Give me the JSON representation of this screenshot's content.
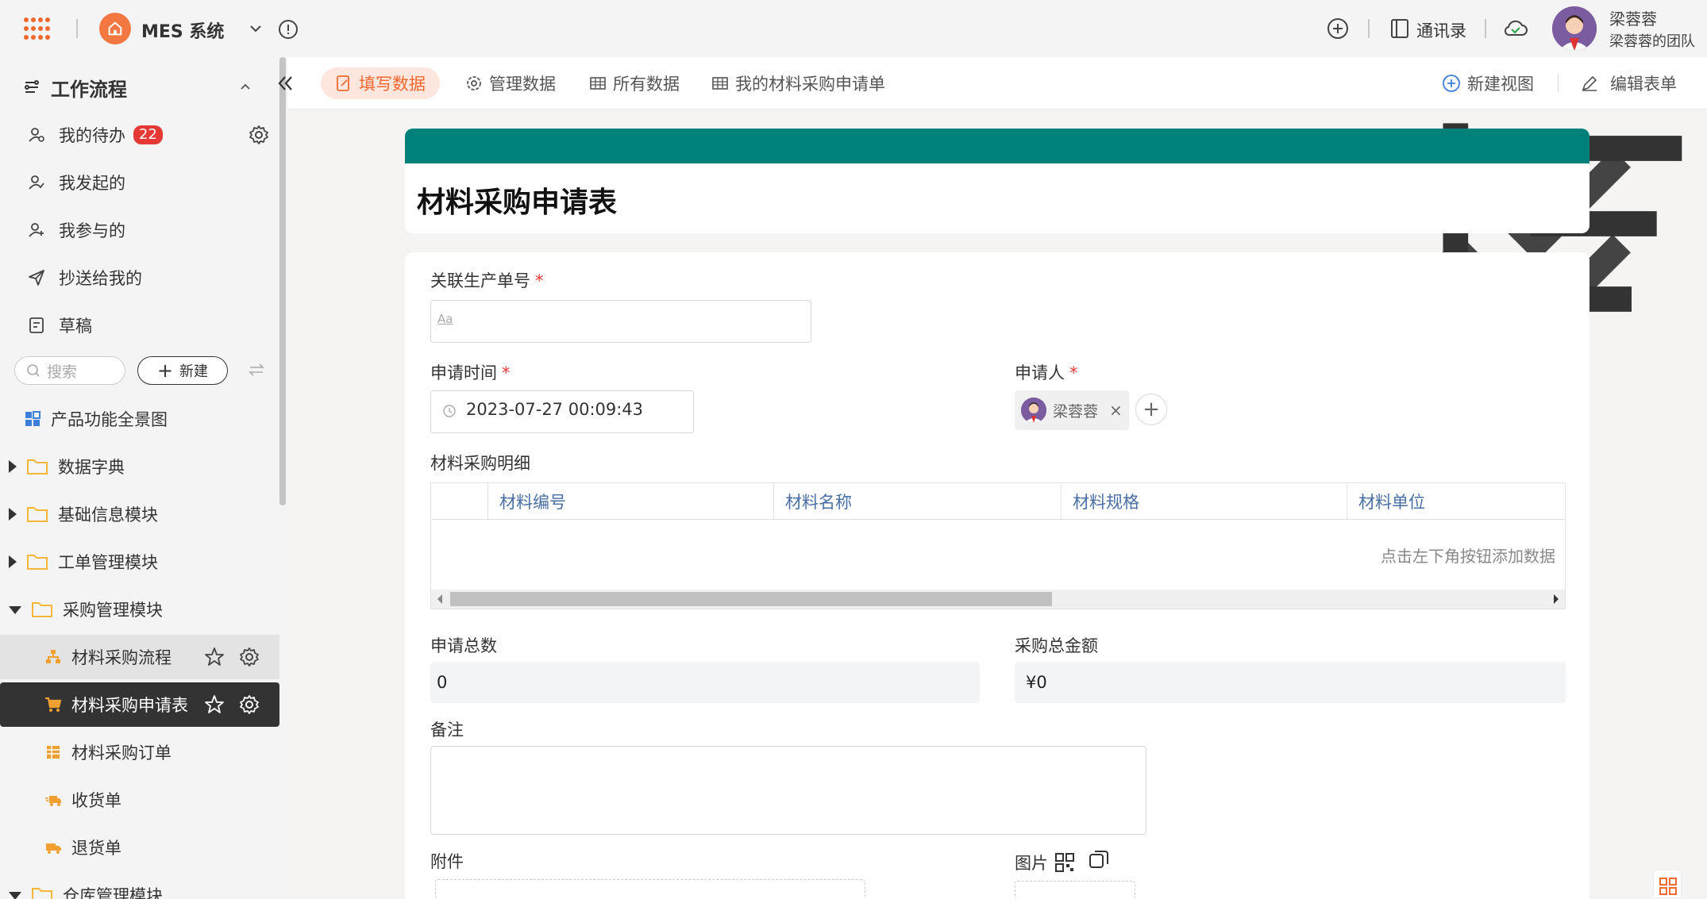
{
  "topbar": {
    "app_name": "MES 系统",
    "contacts_label": "通讯录",
    "user_name": "梁蓉蓉",
    "user_team": "梁蓉蓉的团队",
    "accent": "#f2682e"
  },
  "sidebar": {
    "workflow_title": "工作流程",
    "items": [
      {
        "label": "我的待办",
        "badge": "22",
        "icon": "todo-icon"
      },
      {
        "label": "我发起的",
        "icon": "user-check-icon"
      },
      {
        "label": "我参与的",
        "icon": "user-plus-icon"
      },
      {
        "label": "抄送给我的",
        "icon": "send-icon"
      },
      {
        "label": "草稿",
        "icon": "draft-icon"
      }
    ],
    "search_placeholder": "搜索",
    "new_label": "新建",
    "overview_label": "产品功能全景图",
    "tree": [
      {
        "label": "数据字典",
        "expanded": false
      },
      {
        "label": "基础信息模块",
        "expanded": false
      },
      {
        "label": "工单管理模块",
        "expanded": false
      },
      {
        "label": "采购管理模块",
        "expanded": true
      },
      {
        "label": "仓库管理模块",
        "expanded": true
      }
    ],
    "children": [
      {
        "label": "材料采购流程",
        "icon": "flow-icon",
        "state": "hover"
      },
      {
        "label": "材料采购申请表",
        "icon": "cart-icon",
        "state": "active"
      },
      {
        "label": "材料采购订单",
        "icon": "table-icon"
      },
      {
        "label": "收货单",
        "icon": "truck-receive-icon"
      },
      {
        "label": "退货单",
        "icon": "truck-return-icon"
      }
    ]
  },
  "tabs": {
    "fill": "填写数据",
    "manage": "管理数据",
    "all": "所有数据",
    "mine": "我的材料采购申请单",
    "new_view": "新建视图",
    "edit_form": "编辑表单"
  },
  "form": {
    "title": "材料采购申请表",
    "band_color": "#00807a",
    "fields": {
      "order_no_label": "关联生产单号",
      "order_no_placeholder": "Aa",
      "apply_time_label": "申请时间",
      "apply_time_value": "2023-07-27 00:09:43",
      "applicant_label": "申请人",
      "applicant_value": "梁蓉蓉",
      "detail_label": "材料采购明细",
      "detail_columns": [
        "材料编号",
        "材料名称",
        "材料规格",
        "材料单位"
      ],
      "detail_empty_hint": "点击左下角按钮添加数据",
      "total_qty_label": "申请总数",
      "total_qty_value": "0",
      "total_amount_label": "采购总金额",
      "total_amount_value": "¥0",
      "remark_label": "备注",
      "attachment_label": "附件",
      "image_label": "图片"
    },
    "required_mark": "*"
  }
}
